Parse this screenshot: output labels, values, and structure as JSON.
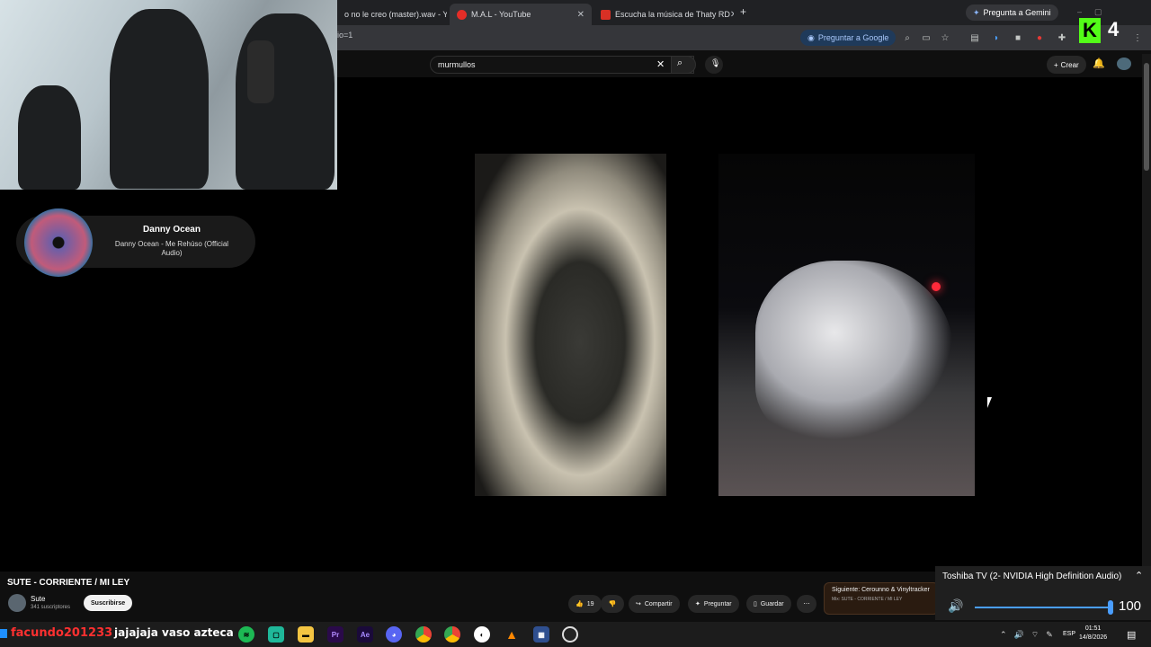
{
  "browser": {
    "tabs": [
      {
        "label": "o no le creo (master).wav - Y",
        "close": "✕"
      },
      {
        "label": "M.A.L - YouTube",
        "close": "✕"
      },
      {
        "label": "Escucha la música de Thaty RD",
        "close": "✕"
      }
    ],
    "new_tab": "+",
    "gemini_button": "Pregunta a Gemini",
    "url_fragment": "dio=1",
    "google_chip": "Preguntar a Google"
  },
  "youtube": {
    "search_value": "murmullos",
    "create_label": "Crear",
    "video_title": "SUTE - CORRIENTE / MI LEY",
    "channel_name": "Sute",
    "channel_subs": "341 suscriptores",
    "subscribe_label": "Suscribirse",
    "like_count": "19",
    "share_label": "Compartir",
    "ask_label": "Preguntar",
    "save_label": "Guardar",
    "up_next_line1": "Siguiente: Cerounno & Vinyltracker",
    "up_next_line2": "Mix: SUTE - CORRIENTE / MI LEY"
  },
  "now_playing": {
    "artist": "Danny Ocean",
    "title": "Danny Ocean - Me Rehúso (Official Audio)"
  },
  "stream_overlay": {
    "badge_letter": "K",
    "badge_number": "4",
    "chat_user": "facundo201233",
    "chat_message": "jajajaja vaso azteca"
  },
  "volume_flyout": {
    "device": "Toshiba TV (2- NVIDIA High Definition Audio)",
    "level": "100",
    "level_fraction": 1.0
  },
  "taskbar": {
    "language": "ESP",
    "time": "01:51",
    "date": "14/8/2026",
    "apps": [
      "spotify",
      "app",
      "explorer",
      "premiere",
      "after-effects",
      "discord",
      "chrome",
      "chrome-alt",
      "capcut",
      "vlc",
      "calculator",
      "obs"
    ]
  },
  "colors": {
    "youtube_bg": "#0f0f0f",
    "badge_green": "#53fc18",
    "chat_user_red": "#ff3030",
    "volume_blue": "#4a9eff"
  }
}
